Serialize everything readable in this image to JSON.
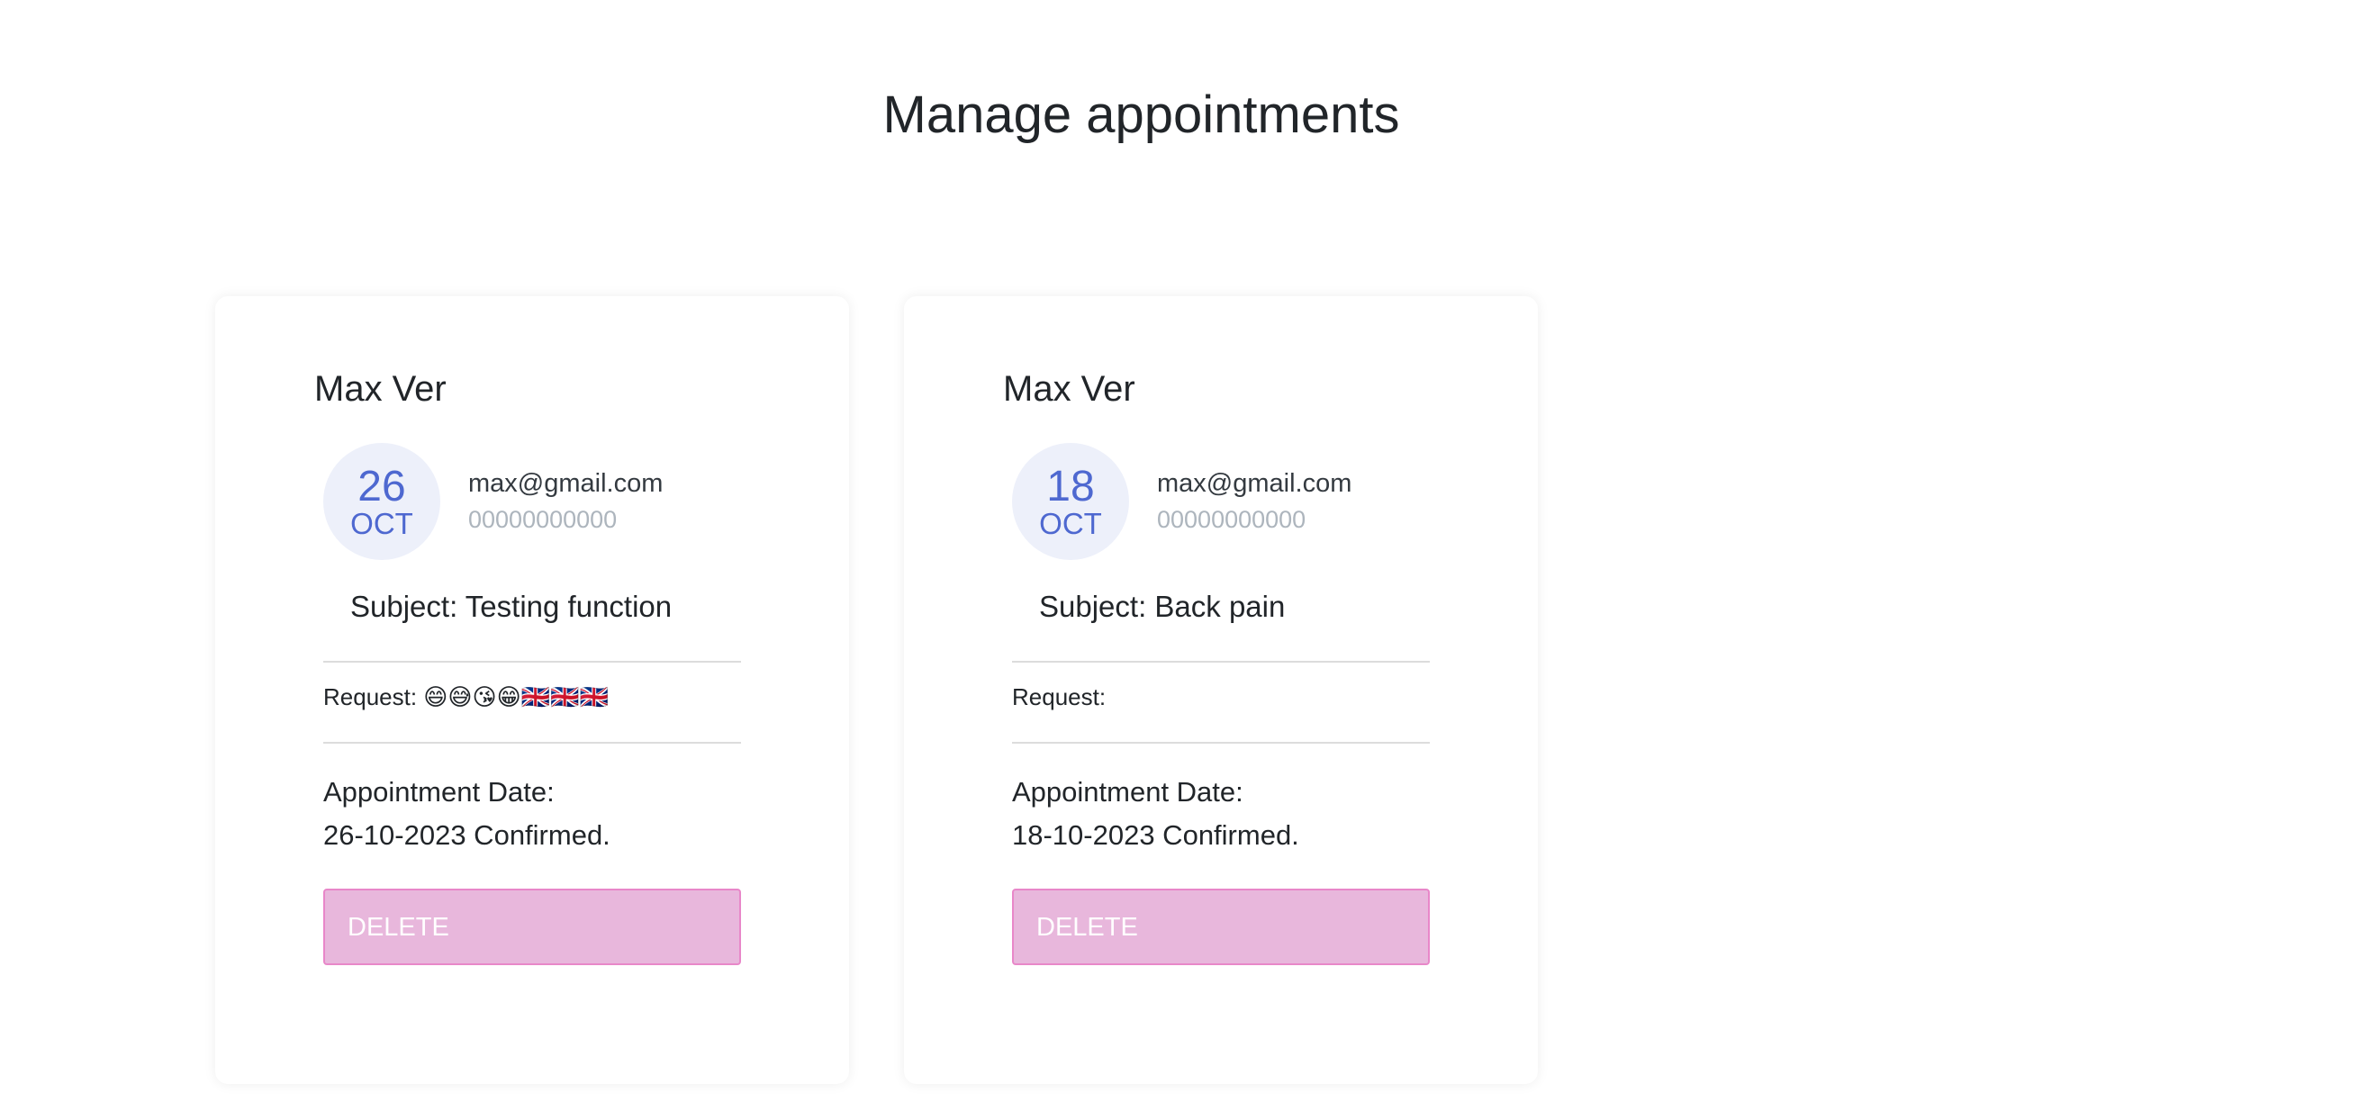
{
  "page": {
    "title": "Manage appointments"
  },
  "appointments": [
    {
      "name": "Max Ver",
      "day": "26",
      "month": "OCT",
      "email": "max@gmail.com",
      "phone": "00000000000",
      "subject": "Subject: Testing function",
      "request": "Request: 😄😅😘😁🇬🇧🇬🇧🇬🇧",
      "date_label": "Appointment Date:",
      "date_value": "26-10-2023 Confirmed.",
      "delete_label": "DELETE"
    },
    {
      "name": "Max Ver",
      "day": "18",
      "month": "OCT",
      "email": "max@gmail.com",
      "phone": "00000000000",
      "subject": "Subject: Back pain",
      "request": "Request:",
      "date_label": "Appointment Date:",
      "date_value": "18-10-2023 Confirmed.",
      "delete_label": "DELETE"
    }
  ],
  "colors": {
    "accent": "#4e68d0",
    "badge_bg": "#edf0fa",
    "delete_bg": "#e8b7dc",
    "delete_border": "#e887c9"
  }
}
